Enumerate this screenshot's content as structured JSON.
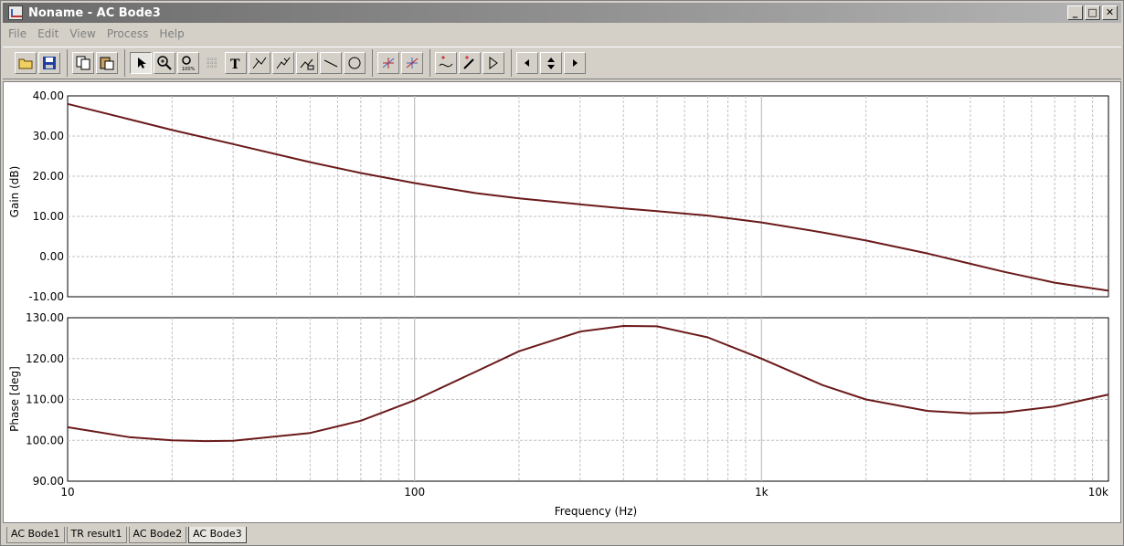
{
  "window": {
    "title": "Noname - AC Bode3",
    "minimize_label": "_",
    "maximize_label": "□",
    "close_label": "✕"
  },
  "menu": [
    "File",
    "Edit",
    "View",
    "Process",
    "Help"
  ],
  "toolbar_icons": [
    "open-icon",
    "save-icon",
    "copy-icon",
    "paste-icon",
    "pointer-icon",
    "zoom-in-icon",
    "zoom-100-icon",
    "grid-icon",
    "text-icon",
    "cursor-a-icon",
    "cursor-b-icon",
    "cursor-tool-icon",
    "line-icon",
    "circle-icon",
    "cross-a-icon",
    "cross-b-icon",
    "add-curve-icon",
    "add-marker-icon",
    "flag-icon",
    "nav-left-icon",
    "nav-up-down-icon",
    "nav-right-icon"
  ],
  "tabs": [
    "AC Bode1",
    "TR result1",
    "AC Bode2",
    "AC Bode3"
  ],
  "active_tab": "AC Bode3",
  "colors": {
    "curve": "#6b1a1a",
    "grid": "#c0c0c0"
  },
  "chart_data": [
    {
      "type": "line",
      "ylabel": "Gain (dB)",
      "x_scale": "log",
      "xlim": [
        10,
        10000
      ],
      "ylim": [
        -10,
        40
      ],
      "yticks": [
        "40.00",
        "30.00",
        "20.00",
        "10.00",
        "0.00",
        "-10.00"
      ],
      "grid": true,
      "x": [
        10,
        15,
        20,
        30,
        50,
        70,
        100,
        150,
        200,
        300,
        400,
        500,
        700,
        1000,
        1500,
        2000,
        3000,
        4000,
        5000,
        7000,
        10000
      ],
      "values": [
        38.0,
        34.2,
        31.5,
        28.0,
        23.5,
        20.8,
        18.3,
        15.8,
        14.5,
        13.0,
        12.0,
        11.3,
        10.2,
        8.5,
        6.0,
        4.0,
        0.8,
        -1.8,
        -3.8,
        -6.5,
        -8.5
      ]
    },
    {
      "type": "line",
      "ylabel": "Phase [deg]",
      "xlabel": "Frequency (Hz)",
      "x_scale": "log",
      "xlim": [
        10,
        10000
      ],
      "ylim": [
        90,
        130
      ],
      "yticks": [
        "130.00",
        "120.00",
        "110.00",
        "100.00",
        "90.00"
      ],
      "xticks": [
        "10",
        "100",
        "1k",
        "10k"
      ],
      "grid": true,
      "x": [
        10,
        15,
        20,
        25,
        30,
        50,
        70,
        100,
        150,
        200,
        300,
        400,
        500,
        700,
        1000,
        1500,
        2000,
        3000,
        4000,
        5000,
        7000,
        10000
      ],
      "values": [
        103.2,
        100.8,
        100.0,
        99.8,
        99.9,
        101.8,
        104.8,
        109.8,
        116.8,
        121.8,
        126.6,
        128.0,
        127.9,
        125.2,
        120.0,
        113.5,
        110.0,
        107.2,
        106.6,
        106.8,
        108.3,
        111.2
      ]
    }
  ]
}
